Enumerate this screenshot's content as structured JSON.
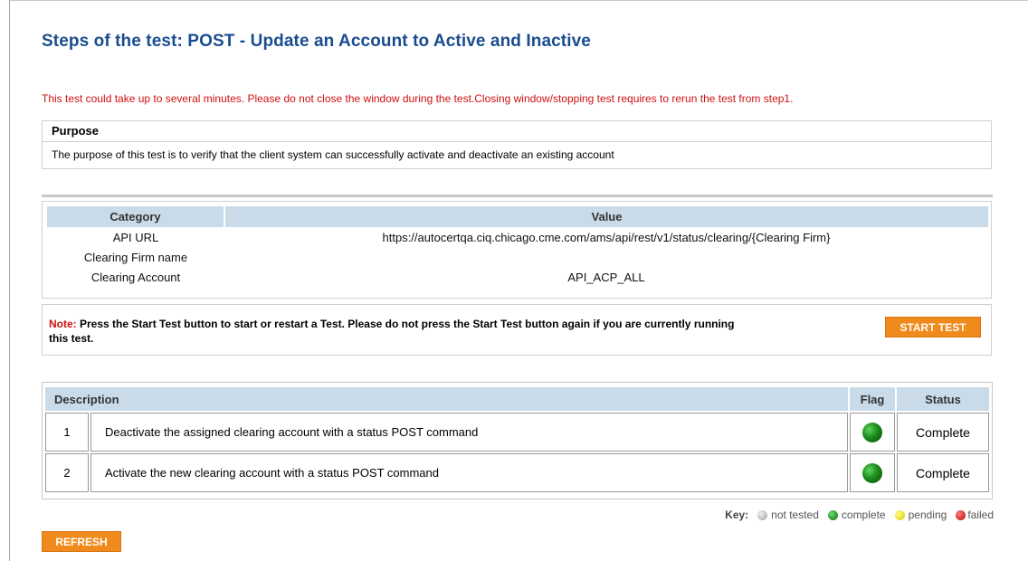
{
  "page": {
    "title": "Steps of the test: POST - Update an Account to Active and Inactive",
    "warning": "This test could take up to several minutes. Please do not close the window during the test.Closing window/stopping test requires to rerun the test from step1."
  },
  "purpose": {
    "heading": "Purpose",
    "text": "The purpose of this test is to verify that the client system can successfully activate and deactivate an existing account"
  },
  "info": {
    "headers": {
      "category": "Category",
      "value": "Value"
    },
    "rows": [
      {
        "category": "API URL",
        "value": "https://autocertqa.ciq.chicago.cme.com/ams/api/rest/v1/status/clearing/{Clearing Firm}"
      },
      {
        "category": "Clearing Firm name",
        "value": ""
      },
      {
        "category": "Clearing Account",
        "value": "API_ACP_ALL"
      }
    ]
  },
  "note": {
    "label": "Note:",
    "text": " Press the Start Test button to start or restart a Test. Please do not press the Start Test button again if you are currently running this test.",
    "start_button": "START TEST"
  },
  "steps": {
    "headers": {
      "description": "Description",
      "flag": "Flag",
      "status": "Status"
    },
    "rows": [
      {
        "num": "1",
        "description": "Deactivate the assigned clearing account with a status POST command",
        "flag": "complete",
        "status": "Complete"
      },
      {
        "num": "2",
        "description": "Activate the new clearing account with a status POST command",
        "flag": "complete",
        "status": "Complete"
      }
    ]
  },
  "key": {
    "label": "Key:",
    "not_tested": "not tested",
    "complete": "complete",
    "pending": "pending",
    "failed": "failed"
  },
  "refresh_button": "REFRESH",
  "colors": {
    "title": "#1a4d8f",
    "warning": "#d01010",
    "button_orange": "#f08a1c",
    "header_blue": "#c9dbe9",
    "flag_green": "#1a8a1a"
  }
}
